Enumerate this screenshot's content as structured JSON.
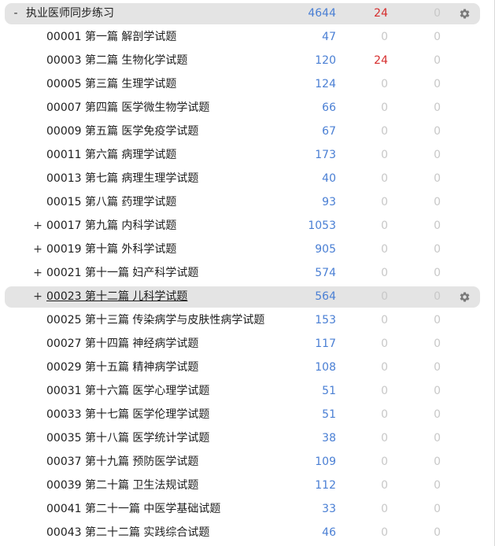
{
  "colors": {
    "new_count": "#4a7fd4",
    "learn_count_nonzero": "#d62d2d",
    "zero_count": "#c8c8c8",
    "highlight_row": "#e4e4e4",
    "gear": "#7a7a7a"
  },
  "decks": [
    {
      "toggle": "-",
      "name": "执业医师同步练习",
      "new": "4644",
      "learn": "24",
      "review": "0",
      "level": 0,
      "highlight": true,
      "gear": true,
      "gear_icon": "gear-icon",
      "current": false
    },
    {
      "toggle": "",
      "name": "00001 第一篇 解剖学试题",
      "new": "47",
      "learn": "0",
      "review": "0",
      "level": 1,
      "highlight": false,
      "gear": false,
      "current": false
    },
    {
      "toggle": "",
      "name": "00003 第二篇 生物化学试题",
      "new": "120",
      "learn": "24",
      "review": "0",
      "level": 1,
      "highlight": false,
      "gear": false,
      "current": false
    },
    {
      "toggle": "",
      "name": "00005 第三篇 生理学试题",
      "new": "124",
      "learn": "0",
      "review": "0",
      "level": 1,
      "highlight": false,
      "gear": false,
      "current": false
    },
    {
      "toggle": "",
      "name": "00007 第四篇 医学微生物学试题",
      "new": "66",
      "learn": "0",
      "review": "0",
      "level": 1,
      "highlight": false,
      "gear": false,
      "current": false
    },
    {
      "toggle": "",
      "name": "00009 第五篇 医学免疫学试题",
      "new": "67",
      "learn": "0",
      "review": "0",
      "level": 1,
      "highlight": false,
      "gear": false,
      "current": false
    },
    {
      "toggle": "",
      "name": "00011 第六篇 病理学试题",
      "new": "173",
      "learn": "0",
      "review": "0",
      "level": 1,
      "highlight": false,
      "gear": false,
      "current": false
    },
    {
      "toggle": "",
      "name": "00013 第七篇 病理生理学试题",
      "new": "40",
      "learn": "0",
      "review": "0",
      "level": 1,
      "highlight": false,
      "gear": false,
      "current": false
    },
    {
      "toggle": "",
      "name": "00015 第八篇 药理学试题",
      "new": "93",
      "learn": "0",
      "review": "0",
      "level": 1,
      "highlight": false,
      "gear": false,
      "current": false
    },
    {
      "toggle": "+",
      "name": "00017 第九篇 内科学试题",
      "new": "1053",
      "learn": "0",
      "review": "0",
      "level": 1,
      "highlight": false,
      "gear": false,
      "current": false
    },
    {
      "toggle": "+",
      "name": "00019 第十篇 外科学试题",
      "new": "905",
      "learn": "0",
      "review": "0",
      "level": 1,
      "highlight": false,
      "gear": false,
      "current": false
    },
    {
      "toggle": "+",
      "name": "00021 第十一篇 妇产科学试题",
      "new": "574",
      "learn": "0",
      "review": "0",
      "level": 1,
      "highlight": false,
      "gear": false,
      "current": false
    },
    {
      "toggle": "+",
      "name": "00023 第十二篇 儿科学试题",
      "new": "564",
      "learn": "0",
      "review": "0",
      "level": 1,
      "highlight": true,
      "gear": true,
      "gear_icon": "gear-icon",
      "current": true
    },
    {
      "toggle": "",
      "name": "00025 第十三篇 传染病学与皮肤性病学试题",
      "new": "153",
      "learn": "0",
      "review": "0",
      "level": 1,
      "highlight": false,
      "gear": false,
      "current": false
    },
    {
      "toggle": "",
      "name": "00027 第十四篇 神经病学试题",
      "new": "117",
      "learn": "0",
      "review": "0",
      "level": 1,
      "highlight": false,
      "gear": false,
      "current": false
    },
    {
      "toggle": "",
      "name": "00029 第十五篇 精神病学试题",
      "new": "108",
      "learn": "0",
      "review": "0",
      "level": 1,
      "highlight": false,
      "gear": false,
      "current": false
    },
    {
      "toggle": "",
      "name": "00031 第十六篇 医学心理学试题",
      "new": "51",
      "learn": "0",
      "review": "0",
      "level": 1,
      "highlight": false,
      "gear": false,
      "current": false
    },
    {
      "toggle": "",
      "name": "00033 第十七篇 医学伦理学试题",
      "new": "51",
      "learn": "0",
      "review": "0",
      "level": 1,
      "highlight": false,
      "gear": false,
      "current": false
    },
    {
      "toggle": "",
      "name": "00035 第十八篇 医学统计学试题",
      "new": "38",
      "learn": "0",
      "review": "0",
      "level": 1,
      "highlight": false,
      "gear": false,
      "current": false
    },
    {
      "toggle": "",
      "name": "00037 第十九篇 预防医学试题",
      "new": "109",
      "learn": "0",
      "review": "0",
      "level": 1,
      "highlight": false,
      "gear": false,
      "current": false
    },
    {
      "toggle": "",
      "name": "00039 第二十篇 卫生法规试题",
      "new": "112",
      "learn": "0",
      "review": "0",
      "level": 1,
      "highlight": false,
      "gear": false,
      "current": false
    },
    {
      "toggle": "",
      "name": "00041 第二十一篇 中医学基础试题",
      "new": "33",
      "learn": "0",
      "review": "0",
      "level": 1,
      "highlight": false,
      "gear": false,
      "current": false
    },
    {
      "toggle": "",
      "name": "00043 第二十二篇 实践综合试题",
      "new": "46",
      "learn": "0",
      "review": "0",
      "level": 1,
      "highlight": false,
      "gear": false,
      "current": false
    }
  ]
}
